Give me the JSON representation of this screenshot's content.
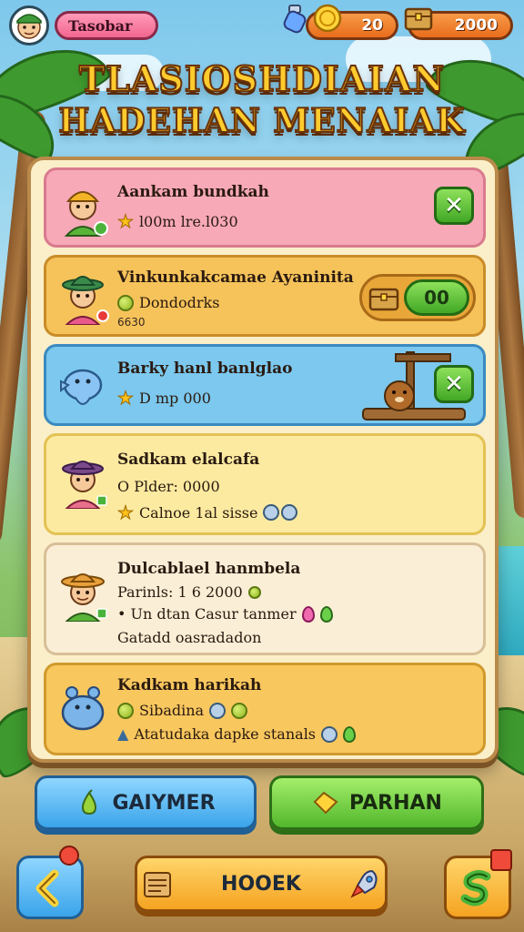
{
  "header": {
    "player_name": "Tasobar",
    "coins": "20",
    "chests": "2000"
  },
  "title": {
    "line1": "TLASIOSHDIAIAN",
    "line2": "HADEHAN MENAIAK"
  },
  "quests": [
    {
      "title": "Aankam bundkah",
      "line1": "l00m lre.l030",
      "color": "pink"
    },
    {
      "title": "Vinkunkakcamae Ayaninita",
      "line1": "Dondodrks",
      "sub": "6630",
      "reward": "00",
      "color": "orange"
    },
    {
      "title": "Barky hanl banlglao",
      "line1": "D mp 000",
      "color": "blue"
    },
    {
      "title": "Sadkam elalcafa",
      "line1": "O Plder: 0000",
      "line2": "Calnoe 1al sisse",
      "color": "yellow"
    },
    {
      "title": "Dulcablael hanmbela",
      "line1": "Parinls: 1 6 2000",
      "line2": "• Un dtan Casur tanmer",
      "line3": "Gatadd oasradadon",
      "color": "cream"
    },
    {
      "title": "Kadkam harikah",
      "line1": "Sibadina",
      "line2": "Atatudaka dapke stanals",
      "color": "gold"
    }
  ],
  "buttons": {
    "left": "GAIYMER",
    "right": "PARHAN",
    "center": "HOOEK"
  },
  "colors": {
    "pink_card": "#f7a9b8",
    "orange_card": "#f6c35a",
    "blue_card": "#7cc8ee",
    "yellow_card": "#fbeaa0",
    "cream_card": "#fbeed6",
    "gold_card": "#f8c75e"
  }
}
